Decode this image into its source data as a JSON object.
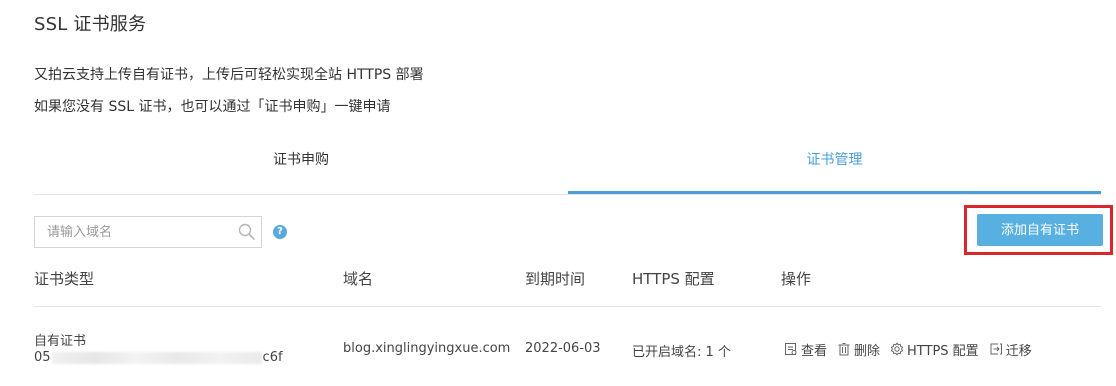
{
  "page": {
    "title": "SSL 证书服务",
    "intro_line1": "又拍云支持上传自有证书，上传后可轻松实现全站 HTTPS 部署",
    "intro_line2": "如果您没有 SSL 证书，也可以通过「证书申购」一键申请"
  },
  "tabs": [
    {
      "label": "证书申购",
      "active": false
    },
    {
      "label": "证书管理",
      "active": true
    }
  ],
  "toolbar": {
    "search_placeholder": "请输入域名",
    "search_value": "",
    "add_button_label": "添加自有证书"
  },
  "table": {
    "headers": [
      "证书类型",
      "域名",
      "到期时间",
      "HTTPS 配置",
      "操作"
    ],
    "rows": [
      {
        "cert_type": "自有证书",
        "cert_id_prefix": "05",
        "cert_id_suffix": "c6f",
        "domain": "blog.xinglingyingxue.com",
        "expiry": "2022-06-03",
        "https": "已开启域名: 1 个",
        "actions": {
          "view": "查看",
          "delete": "删除",
          "https_config": "HTTPS 配置",
          "migrate": "迁移"
        }
      }
    ]
  },
  "colors": {
    "accent": "#4a9fd8",
    "button": "#58b0e0",
    "highlight": "#d9262b"
  },
  "icons": [
    "search-icon",
    "help-icon",
    "view-icon",
    "delete-icon",
    "settings-icon",
    "migrate-icon"
  ]
}
